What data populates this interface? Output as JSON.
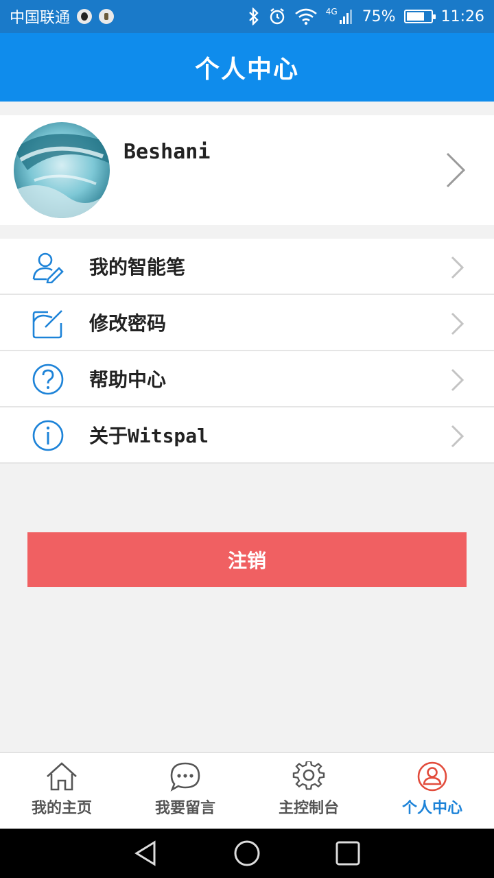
{
  "status_bar": {
    "carrier": "中国联通",
    "network": "4G",
    "battery": "75%",
    "battery_level": 0.75,
    "time": "11:26"
  },
  "header": {
    "title": "个人中心"
  },
  "profile": {
    "name": "Beshani"
  },
  "menu": {
    "items": [
      {
        "label": "我的智能笔",
        "icon": "user-pen-icon"
      },
      {
        "label": "修改密码",
        "icon": "edit-box-icon"
      },
      {
        "label": "帮助中心",
        "icon": "question-circle-icon"
      },
      {
        "label": "关于Witspal",
        "icon": "info-circle-icon"
      }
    ]
  },
  "logout": {
    "label": "注销"
  },
  "bottom_nav": {
    "items": [
      {
        "label": "我的主页",
        "icon": "home-icon"
      },
      {
        "label": "我要留言",
        "icon": "chat-bubble-icon"
      },
      {
        "label": "主控制台",
        "icon": "gear-icon"
      },
      {
        "label": "个人中心",
        "icon": "user-circle-icon",
        "active": true
      }
    ]
  },
  "colors": {
    "status_bar": "#1a7ac9",
    "header": "#0f8cec",
    "accent": "#1d83d8",
    "logout": "#f06062",
    "background": "#f2f2f2"
  }
}
